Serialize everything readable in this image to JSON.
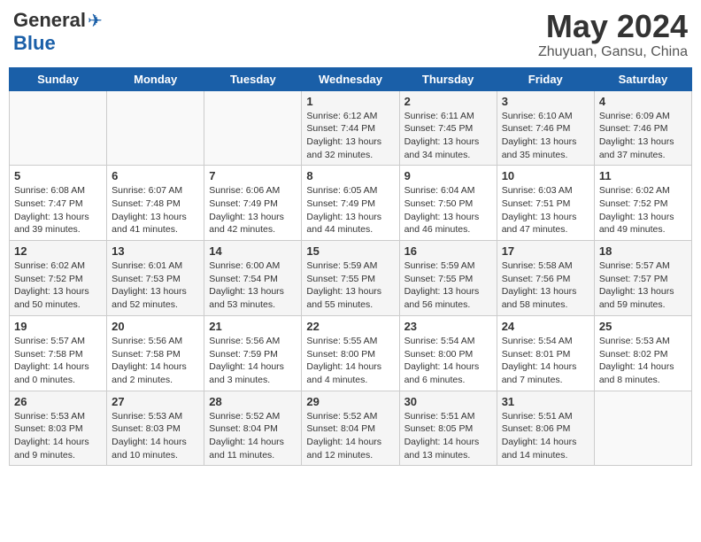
{
  "header": {
    "logo_general": "General",
    "logo_blue": "Blue",
    "month": "May 2024",
    "location": "Zhuyuan, Gansu, China"
  },
  "weekdays": [
    "Sunday",
    "Monday",
    "Tuesday",
    "Wednesday",
    "Thursday",
    "Friday",
    "Saturday"
  ],
  "weeks": [
    [
      {
        "day": "",
        "info": ""
      },
      {
        "day": "",
        "info": ""
      },
      {
        "day": "",
        "info": ""
      },
      {
        "day": "1",
        "info": "Sunrise: 6:12 AM\nSunset: 7:44 PM\nDaylight: 13 hours\nand 32 minutes."
      },
      {
        "day": "2",
        "info": "Sunrise: 6:11 AM\nSunset: 7:45 PM\nDaylight: 13 hours\nand 34 minutes."
      },
      {
        "day": "3",
        "info": "Sunrise: 6:10 AM\nSunset: 7:46 PM\nDaylight: 13 hours\nand 35 minutes."
      },
      {
        "day": "4",
        "info": "Sunrise: 6:09 AM\nSunset: 7:46 PM\nDaylight: 13 hours\nand 37 minutes."
      }
    ],
    [
      {
        "day": "5",
        "info": "Sunrise: 6:08 AM\nSunset: 7:47 PM\nDaylight: 13 hours\nand 39 minutes."
      },
      {
        "day": "6",
        "info": "Sunrise: 6:07 AM\nSunset: 7:48 PM\nDaylight: 13 hours\nand 41 minutes."
      },
      {
        "day": "7",
        "info": "Sunrise: 6:06 AM\nSunset: 7:49 PM\nDaylight: 13 hours\nand 42 minutes."
      },
      {
        "day": "8",
        "info": "Sunrise: 6:05 AM\nSunset: 7:49 PM\nDaylight: 13 hours\nand 44 minutes."
      },
      {
        "day": "9",
        "info": "Sunrise: 6:04 AM\nSunset: 7:50 PM\nDaylight: 13 hours\nand 46 minutes."
      },
      {
        "day": "10",
        "info": "Sunrise: 6:03 AM\nSunset: 7:51 PM\nDaylight: 13 hours\nand 47 minutes."
      },
      {
        "day": "11",
        "info": "Sunrise: 6:02 AM\nSunset: 7:52 PM\nDaylight: 13 hours\nand 49 minutes."
      }
    ],
    [
      {
        "day": "12",
        "info": "Sunrise: 6:02 AM\nSunset: 7:52 PM\nDaylight: 13 hours\nand 50 minutes."
      },
      {
        "day": "13",
        "info": "Sunrise: 6:01 AM\nSunset: 7:53 PM\nDaylight: 13 hours\nand 52 minutes."
      },
      {
        "day": "14",
        "info": "Sunrise: 6:00 AM\nSunset: 7:54 PM\nDaylight: 13 hours\nand 53 minutes."
      },
      {
        "day": "15",
        "info": "Sunrise: 5:59 AM\nSunset: 7:55 PM\nDaylight: 13 hours\nand 55 minutes."
      },
      {
        "day": "16",
        "info": "Sunrise: 5:59 AM\nSunset: 7:55 PM\nDaylight: 13 hours\nand 56 minutes."
      },
      {
        "day": "17",
        "info": "Sunrise: 5:58 AM\nSunset: 7:56 PM\nDaylight: 13 hours\nand 58 minutes."
      },
      {
        "day": "18",
        "info": "Sunrise: 5:57 AM\nSunset: 7:57 PM\nDaylight: 13 hours\nand 59 minutes."
      }
    ],
    [
      {
        "day": "19",
        "info": "Sunrise: 5:57 AM\nSunset: 7:58 PM\nDaylight: 14 hours\nand 0 minutes."
      },
      {
        "day": "20",
        "info": "Sunrise: 5:56 AM\nSunset: 7:58 PM\nDaylight: 14 hours\nand 2 minutes."
      },
      {
        "day": "21",
        "info": "Sunrise: 5:56 AM\nSunset: 7:59 PM\nDaylight: 14 hours\nand 3 minutes."
      },
      {
        "day": "22",
        "info": "Sunrise: 5:55 AM\nSunset: 8:00 PM\nDaylight: 14 hours\nand 4 minutes."
      },
      {
        "day": "23",
        "info": "Sunrise: 5:54 AM\nSunset: 8:00 PM\nDaylight: 14 hours\nand 6 minutes."
      },
      {
        "day": "24",
        "info": "Sunrise: 5:54 AM\nSunset: 8:01 PM\nDaylight: 14 hours\nand 7 minutes."
      },
      {
        "day": "25",
        "info": "Sunrise: 5:53 AM\nSunset: 8:02 PM\nDaylight: 14 hours\nand 8 minutes."
      }
    ],
    [
      {
        "day": "26",
        "info": "Sunrise: 5:53 AM\nSunset: 8:03 PM\nDaylight: 14 hours\nand 9 minutes."
      },
      {
        "day": "27",
        "info": "Sunrise: 5:53 AM\nSunset: 8:03 PM\nDaylight: 14 hours\nand 10 minutes."
      },
      {
        "day": "28",
        "info": "Sunrise: 5:52 AM\nSunset: 8:04 PM\nDaylight: 14 hours\nand 11 minutes."
      },
      {
        "day": "29",
        "info": "Sunrise: 5:52 AM\nSunset: 8:04 PM\nDaylight: 14 hours\nand 12 minutes."
      },
      {
        "day": "30",
        "info": "Sunrise: 5:51 AM\nSunset: 8:05 PM\nDaylight: 14 hours\nand 13 minutes."
      },
      {
        "day": "31",
        "info": "Sunrise: 5:51 AM\nSunset: 8:06 PM\nDaylight: 14 hours\nand 14 minutes."
      },
      {
        "day": "",
        "info": ""
      }
    ]
  ]
}
